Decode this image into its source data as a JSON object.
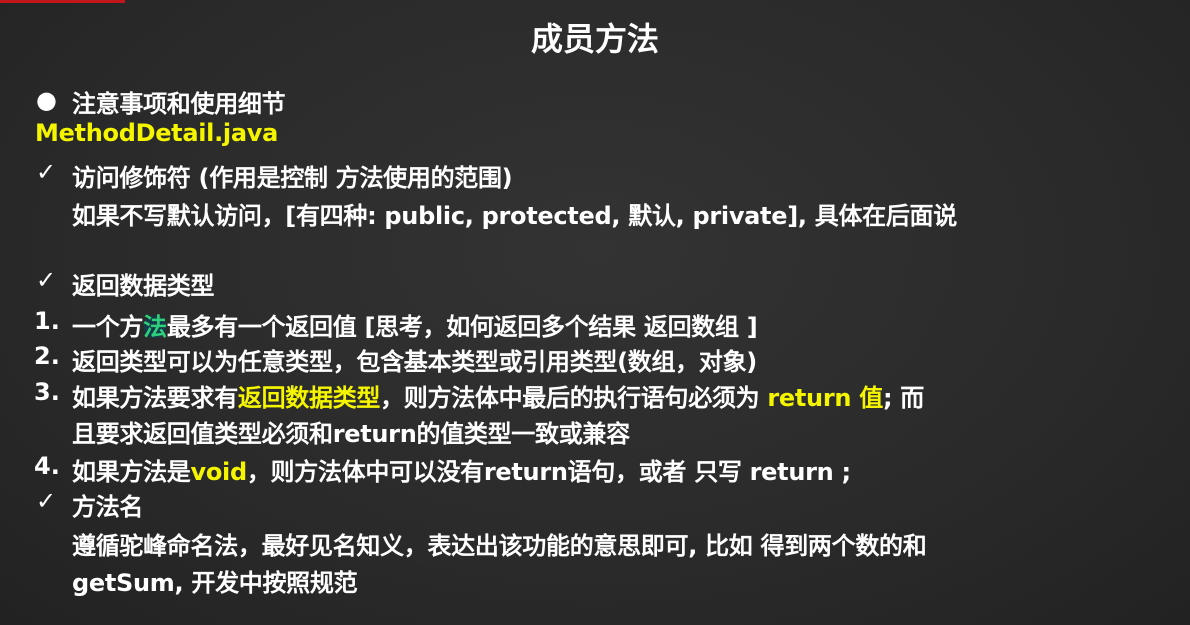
{
  "title": "成员方法",
  "section": {
    "bullet": "●",
    "heading": "注意事项和使用细节"
  },
  "filename": "MethodDetail.java",
  "access": {
    "check": "✓",
    "heading": "访问修饰符 (作用是控制 方法使用的范围)",
    "detail": "如果不写默认访问，[有四种: public, protected, 默认, private], 具体在后面说"
  },
  "return_type": {
    "check": "✓",
    "heading": "返回数据类型",
    "items": [
      {
        "num": "1.",
        "a": "一个方",
        "hl": "法",
        "b": "最多有一个返回值 [思考，如何返回多个结果 返回数组 ]"
      },
      {
        "num": "2.",
        "text": "返回类型可以为任意类型，包含基本类型或引用类型(数组，对象)"
      },
      {
        "num": "3.",
        "a": "如果方法要求有",
        "y1": "返回数据类型",
        "b": "，则方法体中最后的执行语句必须为 ",
        "y2": "return 值",
        "c": "; 而",
        "cont": "且要求返回值类型必须和return的值类型一致或兼容"
      },
      {
        "num": "4.",
        "a": "如果方法是",
        "y1": "void",
        "b": "，则方法体中可以没有return语句，或者 只写 return ;"
      }
    ]
  },
  "method_name": {
    "check": "✓",
    "heading": "方法名",
    "detail1": "遵循驼峰命名法，最好见名知义，表达出该功能的意思即可, 比如 得到两个数的和",
    "detail2": "getSum, 开发中按照规范"
  },
  "colors": {
    "highlight": "#f5f500",
    "background": "#2b2b2b"
  }
}
